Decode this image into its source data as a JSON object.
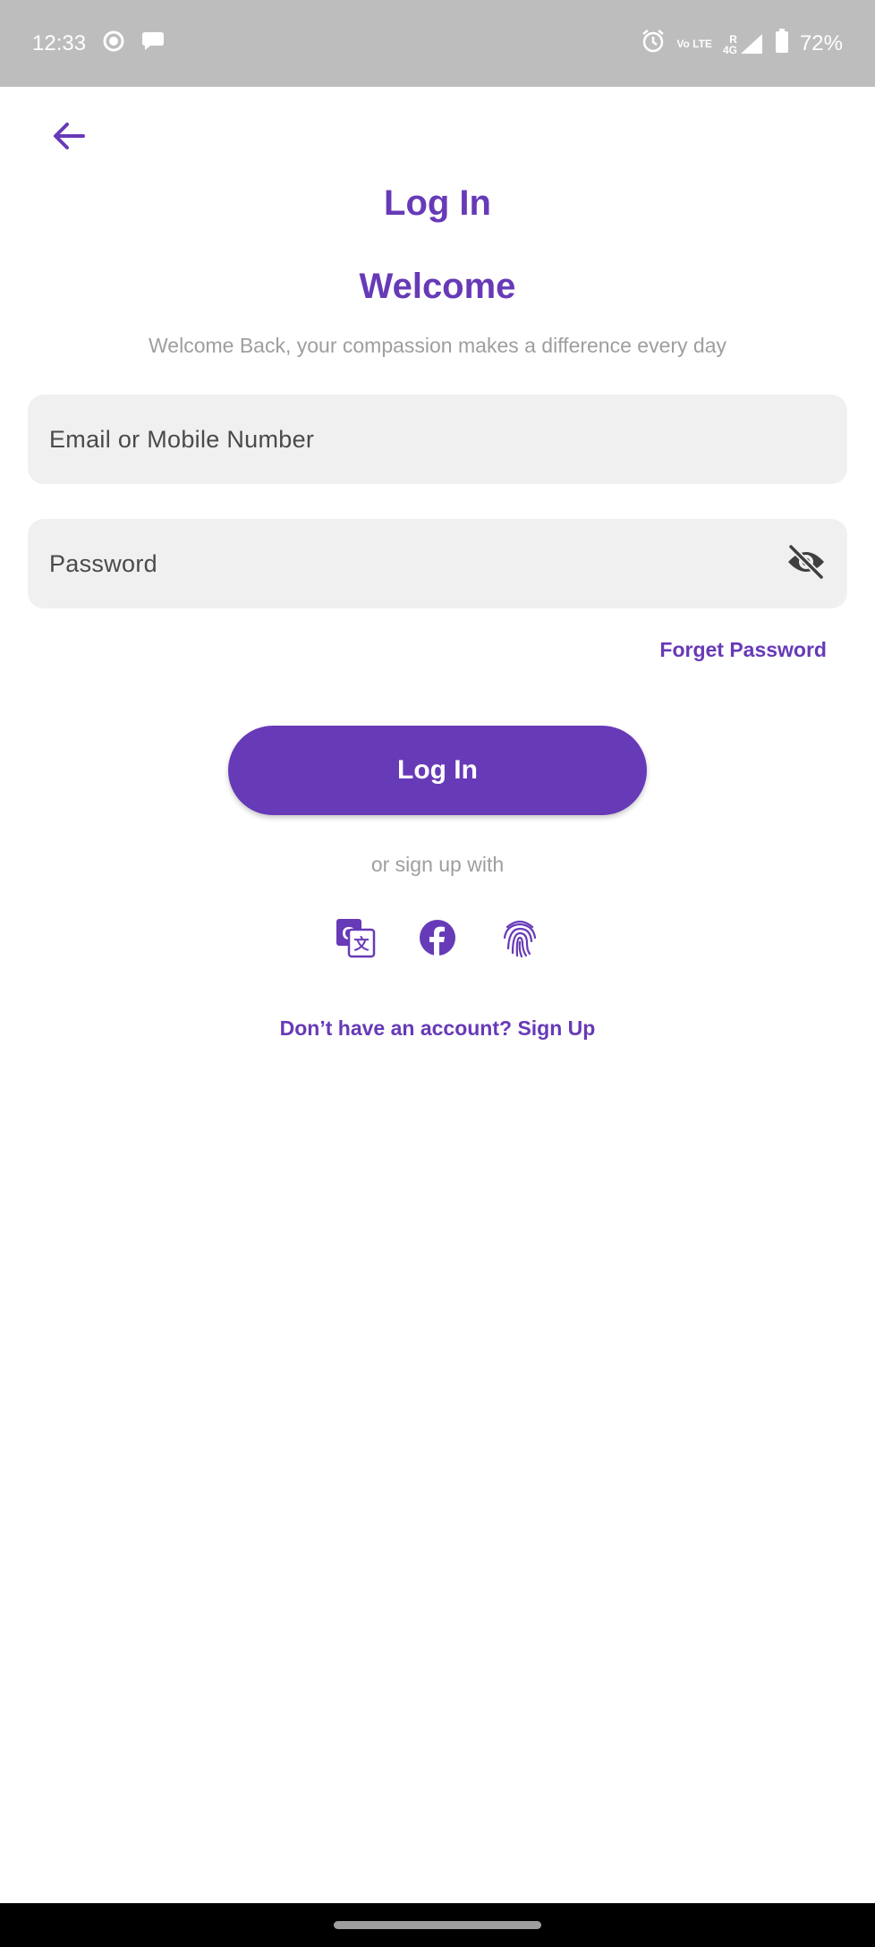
{
  "status_bar": {
    "time": "12:33",
    "battery_percent": "72%",
    "volte_label": "Vo LTE",
    "network_label": "4G",
    "roaming_label": "R",
    "icons": [
      "screen-record-icon",
      "message-bubble-icon",
      "alarm-icon",
      "volte-icon",
      "signal-icon",
      "battery-icon"
    ]
  },
  "header": {
    "title": "Log In"
  },
  "welcome": {
    "heading": "Welcome",
    "subtitle": "Welcome Back, your compassion makes a difference every day"
  },
  "form": {
    "email_placeholder": "Email or Mobile Number",
    "email_value": "",
    "password_placeholder": "Password",
    "password_value": "",
    "password_visible": false,
    "forget_password_label": "Forget Password",
    "login_label": "Log In"
  },
  "social": {
    "label": "or sign up with",
    "providers": [
      "translate-icon",
      "facebook-icon",
      "fingerprint-icon"
    ]
  },
  "footer": {
    "signup_label": "Don’t have an account? Sign Up"
  },
  "colors": {
    "accent": "#673ab7",
    "status_bar": "#bdbdbd",
    "field_background": "#f0f0f0",
    "muted_text": "#9e9e9e"
  }
}
